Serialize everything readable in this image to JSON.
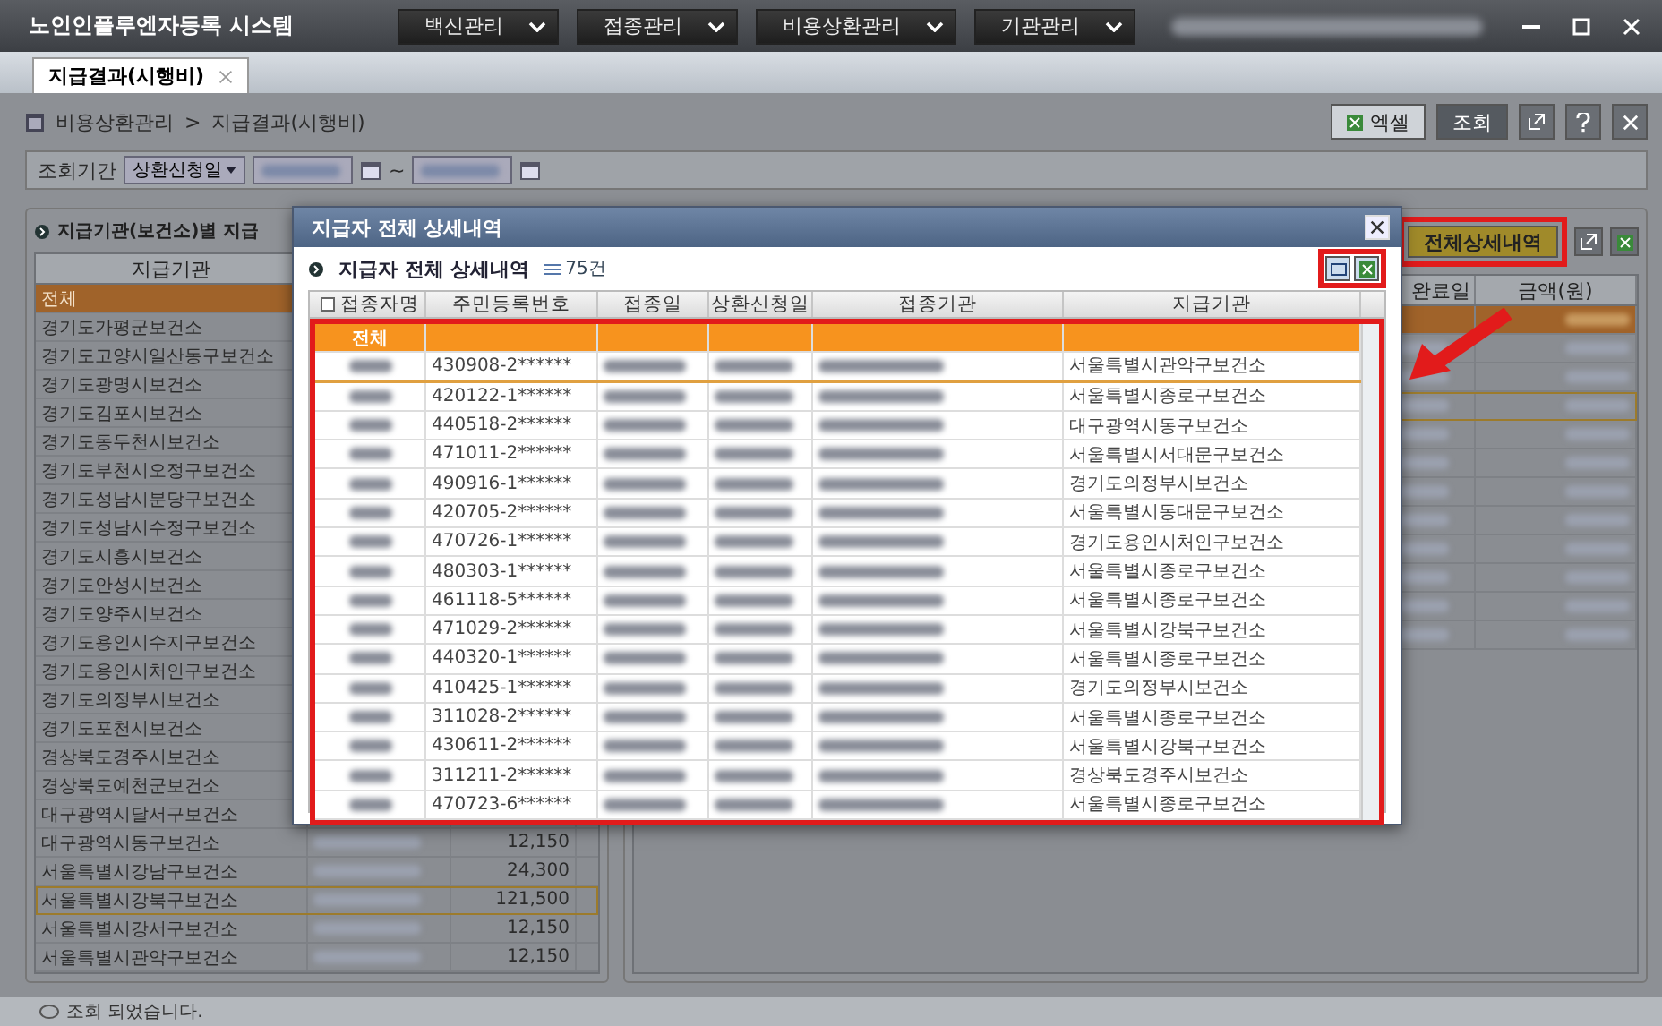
{
  "window": {
    "title": "노인인플루엔자등록 시스템",
    "menus": [
      {
        "label": "백신관리"
      },
      {
        "label": "접종관리"
      },
      {
        "label": "비용상환관리"
      },
      {
        "label": "기관관리"
      }
    ]
  },
  "tabs": [
    {
      "label": "지급결과(시행비)",
      "selected": true
    }
  ],
  "breadcrumb": {
    "items": [
      "비용상환관리",
      "지급결과(시행비)"
    ],
    "separator": ">"
  },
  "toolbar": {
    "excel": "엑셀",
    "search": "조회"
  },
  "filter": {
    "label": "조회기간",
    "date_type": "상환신청일",
    "range_separator": "~"
  },
  "left_panel": {
    "title": "지급기관(보건소)별 지급",
    "columns": [
      "지급기관"
    ],
    "rows": [
      {
        "name": "전체",
        "selected": true,
        "focused": false
      },
      {
        "name": "경기도가평군보건소",
        "selected": false,
        "focused": false
      },
      {
        "name": "경기도고양시일산동구보건소",
        "selected": false,
        "focused": false
      },
      {
        "name": "경기도광명시보건소",
        "selected": false,
        "focused": false
      },
      {
        "name": "경기도김포시보건소",
        "selected": false,
        "focused": false
      },
      {
        "name": "경기도동두천시보건소",
        "selected": false,
        "focused": false
      },
      {
        "name": "경기도부천시오정구보건소",
        "selected": false,
        "focused": false
      },
      {
        "name": "경기도성남시분당구보건소",
        "selected": false,
        "focused": false
      },
      {
        "name": "경기도성남시수정구보건소",
        "selected": false,
        "focused": false
      },
      {
        "name": "경기도시흥시보건소",
        "selected": false,
        "focused": false
      },
      {
        "name": "경기도안성시보건소",
        "selected": false,
        "focused": false
      },
      {
        "name": "경기도양주시보건소",
        "selected": false,
        "focused": false
      },
      {
        "name": "경기도용인시수지구보건소",
        "selected": false,
        "focused": false
      },
      {
        "name": "경기도용인시처인구보건소",
        "selected": false,
        "focused": false
      },
      {
        "name": "경기도의정부시보건소",
        "selected": false,
        "focused": false
      },
      {
        "name": "경기도포천시보건소",
        "selected": false,
        "focused": false
      },
      {
        "name": "경상북도경주시보건소",
        "selected": false,
        "focused": false
      },
      {
        "name": "경상북도예천군보건소",
        "selected": false,
        "focused": false
      },
      {
        "name": "대구광역시달서구보건소",
        "selected": false,
        "focused": false
      },
      {
        "name": "대구광역시동구보건소",
        "amount": "12,150",
        "selected": false,
        "focused": false
      },
      {
        "name": "서울특별시강남구보건소",
        "amount": "24,300",
        "selected": false,
        "focused": false
      },
      {
        "name": "서울특별시강북구보건소",
        "amount": "121,500",
        "selected": false,
        "focused": true
      },
      {
        "name": "서울특별시강서구보건소",
        "amount": "12,150",
        "selected": false,
        "focused": false
      },
      {
        "name": "서울특별시관악구보건소",
        "amount": "12,150",
        "selected": false,
        "focused": false
      }
    ]
  },
  "right_panel": {
    "button": "전체상세내역",
    "columns": [
      "완료일",
      "금액(원)"
    ]
  },
  "dialog": {
    "title": "지급자 전체 상세내역",
    "heading": "지급자 전체 상세내역",
    "count": "75건",
    "columns": [
      "접종자명",
      "주민등록번호",
      "접종일",
      "상환신청일",
      "접종기관",
      "지급기관"
    ],
    "total_row": "전체",
    "rows": [
      {
        "id": "430908-2******",
        "payer": "서울특별시관악구보건소",
        "selected": true
      },
      {
        "id": "420122-1******",
        "payer": "서울특별시종로구보건소",
        "selected": false
      },
      {
        "id": "440518-2******",
        "payer": "대구광역시동구보건소",
        "selected": false
      },
      {
        "id": "471011-2******",
        "payer": "서울특별시서대문구보건소",
        "selected": false
      },
      {
        "id": "490916-1******",
        "payer": "경기도의정부시보건소",
        "selected": false
      },
      {
        "id": "420705-2******",
        "payer": "서울특별시동대문구보건소",
        "selected": false
      },
      {
        "id": "470726-1******",
        "payer": "경기도용인시처인구보건소",
        "selected": false
      },
      {
        "id": "480303-1******",
        "payer": "서울특별시종로구보건소",
        "selected": false
      },
      {
        "id": "461118-5******",
        "payer": "서울특별시종로구보건소",
        "selected": false
      },
      {
        "id": "471029-2******",
        "payer": "서울특별시강북구보건소",
        "selected": false
      },
      {
        "id": "440320-1******",
        "payer": "서울특별시종로구보건소",
        "selected": false
      },
      {
        "id": "410425-1******",
        "payer": "경기도의정부시보건소",
        "selected": false
      },
      {
        "id": "311028-2******",
        "payer": "서울특별시종로구보건소",
        "selected": false
      },
      {
        "id": "430611-2******",
        "payer": "서울특별시강북구보건소",
        "selected": false
      },
      {
        "id": "311211-2******",
        "payer": "경상북도경주시보건소",
        "selected": false
      },
      {
        "id": "470723-6******",
        "payer": "서울특별시종로구보건소",
        "selected": false
      }
    ]
  },
  "status_bar": "조회 되었습니다."
}
